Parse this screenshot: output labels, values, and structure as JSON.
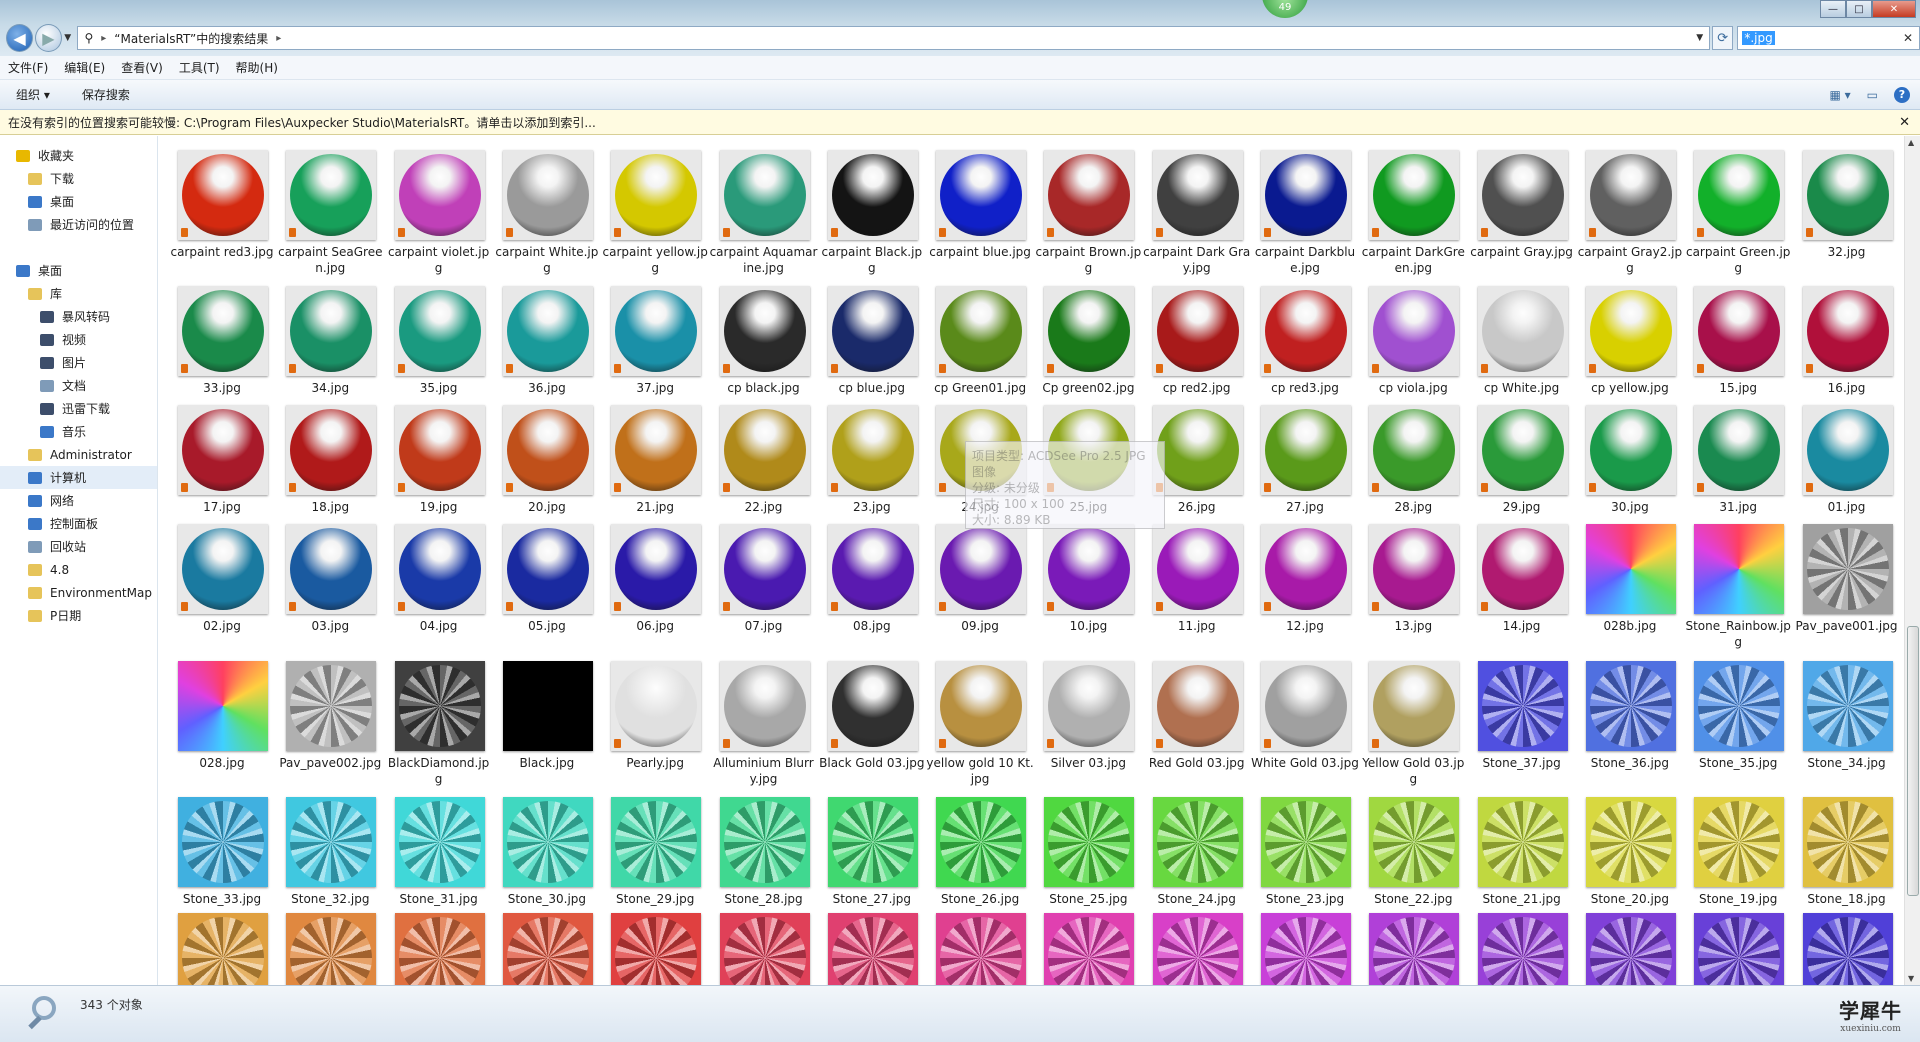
{
  "window": {
    "address_path": "“MaterialsRT”中的搜索结果",
    "search_value": "*.jpg",
    "notify_badge": "49",
    "controls": {
      "minimize": "—",
      "maximize": "□",
      "close": "✕"
    }
  },
  "menu": [
    "文件(F)",
    "编辑(E)",
    "查看(V)",
    "工具(T)",
    "帮助(H)"
  ],
  "toolbar": {
    "organize": "组织 ▾",
    "save_search": "保存搜索"
  },
  "infobar": {
    "text": "在没有索引的位置搜索可能较慢: C:\\Program Files\\Auxpecker Studio\\MaterialsRT。请单击以添加到索引..."
  },
  "sidebar": [
    {
      "label": "收藏夹",
      "indent": 0,
      "icon": "star-icon",
      "color": "#e8b800"
    },
    {
      "label": "下载",
      "indent": 1,
      "icon": "folder-icon",
      "color": "#e6c45a"
    },
    {
      "label": "桌面",
      "indent": 1,
      "icon": "desktop-icon",
      "color": "#3b78c8"
    },
    {
      "label": "最近访问的位置",
      "indent": 1,
      "icon": "recent-icon",
      "color": "#7f9bb8"
    },
    {
      "label": "",
      "indent": 0,
      "icon": "",
      "color": ""
    },
    {
      "label": "桌面",
      "indent": 0,
      "icon": "desktop-icon",
      "color": "#3b78c8"
    },
    {
      "label": "库",
      "indent": 1,
      "icon": "library-icon",
      "color": "#e6c45a"
    },
    {
      "label": "暴风转码",
      "indent": 2,
      "icon": "app-icon",
      "color": "#3d4e6b"
    },
    {
      "label": "视频",
      "indent": 2,
      "icon": "video-icon",
      "color": "#3d4e6b"
    },
    {
      "label": "图片",
      "indent": 2,
      "icon": "picture-icon",
      "color": "#3d4e6b"
    },
    {
      "label": "文档",
      "indent": 2,
      "icon": "document-icon",
      "color": "#7f9bb8"
    },
    {
      "label": "迅雷下载",
      "indent": 2,
      "icon": "download-icon",
      "color": "#3d4e6b"
    },
    {
      "label": "音乐",
      "indent": 2,
      "icon": "music-icon",
      "color": "#3b78c8"
    },
    {
      "label": "Administrator",
      "indent": 1,
      "icon": "user-folder-icon",
      "color": "#e6c45a"
    },
    {
      "label": "计算机",
      "indent": 1,
      "icon": "computer-icon",
      "color": "#3b78c8"
    },
    {
      "label": "网络",
      "indent": 1,
      "icon": "network-icon",
      "color": "#3b78c8"
    },
    {
      "label": "控制面板",
      "indent": 1,
      "icon": "control-panel-icon",
      "color": "#3b78c8"
    },
    {
      "label": "回收站",
      "indent": 1,
      "icon": "recycle-bin-icon",
      "color": "#7f9bb8"
    },
    {
      "label": "4.8",
      "indent": 1,
      "icon": "folder-icon",
      "color": "#e6c45a"
    },
    {
      "label": "EnvironmentMap",
      "indent": 1,
      "icon": "folder-icon",
      "color": "#e6c45a"
    },
    {
      "label": "P日期",
      "indent": 1,
      "icon": "folder-icon",
      "color": "#e6c45a"
    }
  ],
  "files": [
    [
      {
        "name": "carpaint red3.jpg",
        "color": "#d42a10",
        "kind": "sphere"
      },
      {
        "name": "carpaint SeaGreen.jpg",
        "color": "#17a05a",
        "kind": "sphere"
      },
      {
        "name": "carpaint violet.jpg",
        "color": "#c040b8",
        "kind": "sphere"
      },
      {
        "name": "carpaint White.jpg",
        "color": "#9a9a9a",
        "kind": "sphere"
      },
      {
        "name": "carpaint yellow.jpg",
        "color": "#d4c800",
        "kind": "sphere"
      },
      {
        "name": "carpaint Aquamarine.jpg",
        "color": "#2a9a7a",
        "kind": "sphere"
      },
      {
        "name": "carpaint Black.jpg",
        "color": "#141414",
        "kind": "sphere"
      },
      {
        "name": "carpaint blue.jpg",
        "color": "#1020c8",
        "kind": "sphere"
      },
      {
        "name": "carpaint Brown.jpg",
        "color": "#a82828",
        "kind": "sphere"
      },
      {
        "name": "carpaint Dark Gray.jpg",
        "color": "#404040",
        "kind": "sphere"
      },
      {
        "name": "carpaint Darkblue.jpg",
        "color": "#0a1a90",
        "kind": "sphere"
      },
      {
        "name": "carpaint DarkGreen.jpg",
        "color": "#109a20",
        "kind": "sphere"
      },
      {
        "name": "carpaint Gray.jpg",
        "color": "#505050",
        "kind": "sphere"
      },
      {
        "name": "carpaint Gray2.jpg",
        "color": "#606060",
        "kind": "sphere"
      },
      {
        "name": "carpaint Green.jpg",
        "color": "#12b02a",
        "kind": "sphere"
      },
      {
        "name": "32.jpg",
        "color": "#1a8a4a",
        "kind": "sphere"
      }
    ],
    [
      {
        "name": "33.jpg",
        "color": "#1a8a4a",
        "kind": "sphere"
      },
      {
        "name": "34.jpg",
        "color": "#1a9066",
        "kind": "sphere"
      },
      {
        "name": "35.jpg",
        "color": "#1a9a80",
        "kind": "sphere"
      },
      {
        "name": "36.jpg",
        "color": "#1a9a9a",
        "kind": "sphere"
      },
      {
        "name": "37.jpg",
        "color": "#1a90a8",
        "kind": "sphere"
      },
      {
        "name": "cp black.jpg",
        "color": "#2a2a2a",
        "kind": "sphere"
      },
      {
        "name": "cp blue.jpg",
        "color": "#1a2a6a",
        "kind": "sphere"
      },
      {
        "name": "cp Green01.jpg",
        "color": "#5a8a1a",
        "kind": "sphere"
      },
      {
        "name": "Cp green02.jpg",
        "color": "#1a7a1a",
        "kind": "sphere"
      },
      {
        "name": "cp red2.jpg",
        "color": "#a81a1a",
        "kind": "sphere"
      },
      {
        "name": "cp red3.jpg",
        "color": "#c02020",
        "kind": "sphere"
      },
      {
        "name": "cp viola.jpg",
        "color": "#a050d0",
        "kind": "sphere"
      },
      {
        "name": "cp White.jpg",
        "color": "#c8c8c8",
        "kind": "sphere"
      },
      {
        "name": "cp yellow.jpg",
        "color": "#d8d000",
        "kind": "sphere"
      },
      {
        "name": "15.jpg",
        "color": "#a8104a",
        "kind": "sphere"
      },
      {
        "name": "16.jpg",
        "color": "#b0103a",
        "kind": "sphere"
      }
    ],
    [
      {
        "name": "17.jpg",
        "color": "#a81a2a",
        "kind": "sphere"
      },
      {
        "name": "18.jpg",
        "color": "#b01a1a",
        "kind": "sphere"
      },
      {
        "name": "19.jpg",
        "color": "#c03a1a",
        "kind": "sphere"
      },
      {
        "name": "20.jpg",
        "color": "#c0501a",
        "kind": "sphere"
      },
      {
        "name": "21.jpg",
        "color": "#c0701a",
        "kind": "sphere"
      },
      {
        "name": "22.jpg",
        "color": "#b08a1a",
        "kind": "sphere"
      },
      {
        "name": "23.jpg",
        "color": "#b0a01a",
        "kind": "sphere"
      },
      {
        "name": "24.jpg",
        "color": "#a8a81a",
        "kind": "sphere"
      },
      {
        "name": "25.jpg",
        "color": "#90a81a",
        "kind": "sphere"
      },
      {
        "name": "26.jpg",
        "color": "#70a01a",
        "kind": "sphere"
      },
      {
        "name": "27.jpg",
        "color": "#5a9a1a",
        "kind": "sphere"
      },
      {
        "name": "28.jpg",
        "color": "#3a9a2a",
        "kind": "sphere"
      },
      {
        "name": "29.jpg",
        "color": "#2a9a3a",
        "kind": "sphere"
      },
      {
        "name": "30.jpg",
        "color": "#1a9a4a",
        "kind": "sphere"
      },
      {
        "name": "31.jpg",
        "color": "#1a8a50",
        "kind": "sphere"
      },
      {
        "name": "01.jpg",
        "color": "#1a8aa0",
        "kind": "sphere"
      }
    ],
    [
      {
        "name": "02.jpg",
        "color": "#1a7aa0",
        "kind": "sphere"
      },
      {
        "name": "03.jpg",
        "color": "#1a5aa0",
        "kind": "sphere"
      },
      {
        "name": "04.jpg",
        "color": "#1a3aa8",
        "kind": "sphere"
      },
      {
        "name": "05.jpg",
        "color": "#1a2aa0",
        "kind": "sphere"
      },
      {
        "name": "06.jpg",
        "color": "#2a1aa8",
        "kind": "sphere"
      },
      {
        "name": "07.jpg",
        "color": "#4a1ab0",
        "kind": "sphere"
      },
      {
        "name": "08.jpg",
        "color": "#5a1ab0",
        "kind": "sphere"
      },
      {
        "name": "09.jpg",
        "color": "#6a1ab0",
        "kind": "sphere"
      },
      {
        "name": "10.jpg",
        "color": "#7a1ab8",
        "kind": "sphere"
      },
      {
        "name": "11.jpg",
        "color": "#9a1ab8",
        "kind": "sphere"
      },
      {
        "name": "12.jpg",
        "color": "#a81aa8",
        "kind": "sphere"
      },
      {
        "name": "13.jpg",
        "color": "#a81a90",
        "kind": "sphere"
      },
      {
        "name": "14.jpg",
        "color": "#b01a70",
        "kind": "sphere"
      },
      {
        "name": "028b.jpg",
        "color": "#40c080",
        "kind": "swatch"
      },
      {
        "name": "Stone_Rainbow.jpg",
        "color": "#8060d0",
        "kind": "swatch"
      },
      {
        "name": "Pav_pave001.jpg",
        "color": "#a0a0a0",
        "kind": "gem"
      }
    ],
    [
      {
        "name": "028.jpg",
        "color": "#60c040",
        "kind": "swatch"
      },
      {
        "name": "Pav_pave002.jpg",
        "color": "#b0b0b0",
        "kind": "gem"
      },
      {
        "name": "BlackDiamond.jpg",
        "color": "#404040",
        "kind": "gem"
      },
      {
        "name": "Black.jpg",
        "color": "#000000",
        "kind": "flat"
      },
      {
        "name": "Pearly.jpg",
        "color": "#e0e0e0",
        "kind": "sphere"
      },
      {
        "name": "Alluminium Blurry.jpg",
        "color": "#a8a8a8",
        "kind": "sphere"
      },
      {
        "name": "Black Gold 03.jpg",
        "color": "#303030",
        "kind": "sphere"
      },
      {
        "name": "yellow gold 10 Kt.jpg",
        "color": "#b89040",
        "kind": "sphere"
      },
      {
        "name": "Silver 03.jpg",
        "color": "#b0b0b0",
        "kind": "sphere"
      },
      {
        "name": "Red Gold 03.jpg",
        "color": "#b07050",
        "kind": "sphere"
      },
      {
        "name": "White Gold 03.jpg",
        "color": "#a0a0a0",
        "kind": "sphere"
      },
      {
        "name": "Yellow Gold 03.jpg",
        "color": "#b0a060",
        "kind": "sphere"
      },
      {
        "name": "Stone_37.jpg",
        "color": "#5050e0",
        "kind": "gem"
      },
      {
        "name": "Stone_36.jpg",
        "color": "#5070e0",
        "kind": "gem"
      },
      {
        "name": "Stone_35.jpg",
        "color": "#5090e8",
        "kind": "gem"
      },
      {
        "name": "Stone_34.jpg",
        "color": "#50a8e8",
        "kind": "gem"
      }
    ],
    [
      {
        "name": "Stone_33.jpg",
        "color": "#40b0e0",
        "kind": "gem"
      },
      {
        "name": "Stone_32.jpg",
        "color": "#40c8e0",
        "kind": "gem"
      },
      {
        "name": "Stone_31.jpg",
        "color": "#40d8d8",
        "kind": "gem"
      },
      {
        "name": "Stone_30.jpg",
        "color": "#40d8c0",
        "kind": "gem"
      },
      {
        "name": "Stone_29.jpg",
        "color": "#40d8a8",
        "kind": "gem"
      },
      {
        "name": "Stone_28.jpg",
        "color": "#40d890",
        "kind": "gem"
      },
      {
        "name": "Stone_27.jpg",
        "color": "#40d870",
        "kind": "gem"
      },
      {
        "name": "Stone_26.jpg",
        "color": "#40d850",
        "kind": "gem"
      },
      {
        "name": "Stone_25.jpg",
        "color": "#50d840",
        "kind": "gem"
      },
      {
        "name": "Stone_24.jpg",
        "color": "#68d840",
        "kind": "gem"
      },
      {
        "name": "Stone_23.jpg",
        "color": "#80d840",
        "kind": "gem"
      },
      {
        "name": "Stone_22.jpg",
        "color": "#a0d840",
        "kind": "gem"
      },
      {
        "name": "Stone_21.jpg",
        "color": "#c0d840",
        "kind": "gem"
      },
      {
        "name": "Stone_20.jpg",
        "color": "#d8d840",
        "kind": "gem"
      },
      {
        "name": "Stone_19.jpg",
        "color": "#e0d040",
        "kind": "gem"
      },
      {
        "name": "Stone_18.jpg",
        "color": "#e0c040",
        "kind": "gem"
      }
    ],
    [
      {
        "name": "",
        "color": "#e0a040",
        "kind": "gem"
      },
      {
        "name": "",
        "color": "#e08840",
        "kind": "gem"
      },
      {
        "name": "",
        "color": "#e07040",
        "kind": "gem"
      },
      {
        "name": "",
        "color": "#e05840",
        "kind": "gem"
      },
      {
        "name": "",
        "color": "#e04040",
        "kind": "gem"
      },
      {
        "name": "",
        "color": "#e04058",
        "kind": "gem"
      },
      {
        "name": "",
        "color": "#e04070",
        "kind": "gem"
      },
      {
        "name": "",
        "color": "#e04090",
        "kind": "gem"
      },
      {
        "name": "",
        "color": "#e040b0",
        "kind": "gem"
      },
      {
        "name": "",
        "color": "#d840c8",
        "kind": "gem"
      },
      {
        "name": "",
        "color": "#c840d8",
        "kind": "gem"
      },
      {
        "name": "",
        "color": "#b040d8",
        "kind": "gem"
      },
      {
        "name": "",
        "color": "#9840d8",
        "kind": "gem"
      },
      {
        "name": "",
        "color": "#8040d8",
        "kind": "gem"
      },
      {
        "name": "",
        "color": "#6840d8",
        "kind": "gem"
      },
      {
        "name": "",
        "color": "#5040d8",
        "kind": "gem"
      }
    ]
  ],
  "tooltip": [
    "项目类型: ACDSee Pro 2.5 JPG 图像",
    "分级: 未分级",
    "尺寸: 100 x 100",
    "大小: 8.89 KB"
  ],
  "status": {
    "count": "343 个对象"
  },
  "watermark": {
    "main": "学犀牛",
    "sub": "xuexiniu.com"
  }
}
